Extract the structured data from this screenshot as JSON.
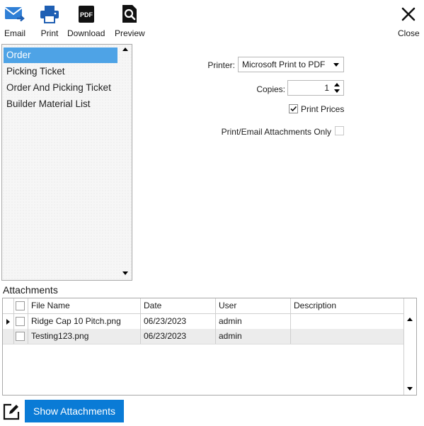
{
  "toolbar": {
    "email_label": "Email",
    "print_label": "Print",
    "download_label": "Download",
    "pdf_icon_text": "PDF",
    "preview_label": "Preview",
    "close_label": "Close"
  },
  "reports": {
    "items": [
      {
        "label": "Order",
        "selected": true
      },
      {
        "label": "Picking Ticket",
        "selected": false
      },
      {
        "label": "Order And Picking Ticket",
        "selected": false
      },
      {
        "label": "Builder Material List",
        "selected": false
      }
    ]
  },
  "options": {
    "printer_label": "Printer:",
    "printer_value": "Microsoft Print to PDF",
    "copies_label": "Copies:",
    "copies_value": "1",
    "print_prices_label": "Print Prices",
    "print_prices_checked": true,
    "attachments_only_label": "Print/Email Attachments Only",
    "attachments_only_checked": false
  },
  "attachments": {
    "title": "Attachments",
    "columns": [
      "File Name",
      "Date",
      "User",
      "Description"
    ],
    "rows": [
      {
        "file_name": "Ridge Cap 10 Pitch.png",
        "date": "06/23/2023",
        "user": "admin",
        "description": "",
        "current": true
      },
      {
        "file_name": "Testing123.png",
        "date": "06/23/2023",
        "user": "admin",
        "description": "",
        "current": false
      }
    ]
  },
  "footer": {
    "show_attachments_label": "Show Attachments"
  },
  "colors": {
    "accent": "#0a7bd6",
    "selection": "#4ea3e6",
    "email_icon": "#2f7fd6",
    "print_icon": "#1f5fb3"
  }
}
